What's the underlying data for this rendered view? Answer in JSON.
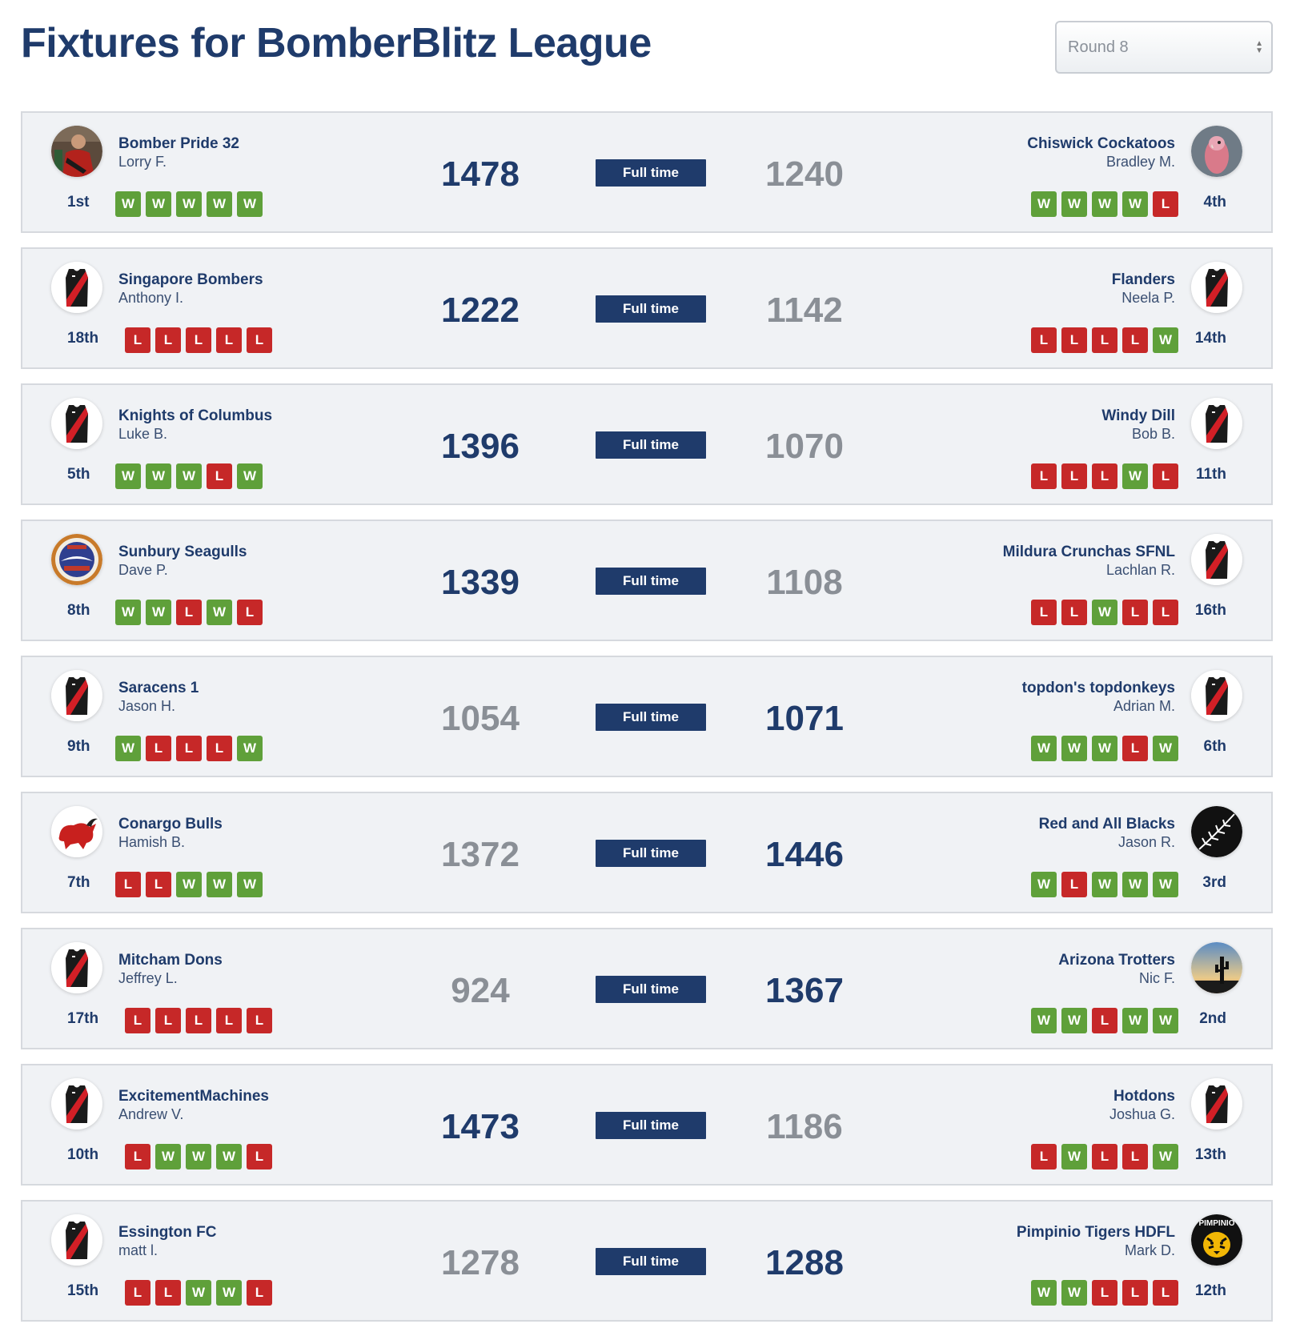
{
  "page": {
    "title": "Fixtures for BomberBlitz League"
  },
  "round_select": {
    "value": "Round 8"
  },
  "colors": {
    "primary": "#1f3b6b",
    "win": "#5fa03a",
    "loss": "#c62828",
    "card_bg": "#f0f2f5"
  },
  "fixtures": [
    {
      "status": "Full time",
      "home": {
        "team": "Bomber Pride 32",
        "coach": "Lorry F.",
        "rank": "1st",
        "form": [
          "W",
          "W",
          "W",
          "W",
          "W"
        ],
        "score": "1478",
        "avatar": "photo-avatar-icon"
      },
      "away": {
        "team": "Chiswick Cockatoos",
        "coach": "Bradley M.",
        "rank": "4th",
        "form": [
          "W",
          "W",
          "W",
          "W",
          "L"
        ],
        "score": "1240",
        "avatar": "cockatoo-avatar-icon"
      },
      "winner": "home"
    },
    {
      "status": "Full time",
      "home": {
        "team": "Singapore Bombers",
        "coach": "Anthony I.",
        "rank": "18th",
        "form": [
          "L",
          "L",
          "L",
          "L",
          "L"
        ],
        "score": "1222",
        "avatar": "guernsey-icon"
      },
      "away": {
        "team": "Flanders",
        "coach": "Neela P.",
        "rank": "14th",
        "form": [
          "L",
          "L",
          "L",
          "L",
          "W"
        ],
        "score": "1142",
        "avatar": "guernsey-icon"
      },
      "winner": "home"
    },
    {
      "status": "Full time",
      "home": {
        "team": "Knights of Columbus",
        "coach": "Luke B.",
        "rank": "5th",
        "form": [
          "W",
          "W",
          "W",
          "L",
          "W"
        ],
        "score": "1396",
        "avatar": "guernsey-icon"
      },
      "away": {
        "team": "Windy Dill",
        "coach": "Bob B.",
        "rank": "11th",
        "form": [
          "L",
          "L",
          "L",
          "W",
          "L"
        ],
        "score": "1070",
        "avatar": "guernsey-icon"
      },
      "winner": "home"
    },
    {
      "status": "Full time",
      "home": {
        "team": "Sunbury Seagulls",
        "coach": "Dave P.",
        "rank": "8th",
        "form": [
          "W",
          "W",
          "L",
          "W",
          "L"
        ],
        "score": "1339",
        "avatar": "seagulls-logo-icon"
      },
      "away": {
        "team": "Mildura Crunchas SFNL",
        "coach": "Lachlan R.",
        "rank": "16th",
        "form": [
          "L",
          "L",
          "W",
          "L",
          "L"
        ],
        "score": "1108",
        "avatar": "guernsey-icon"
      },
      "winner": "home"
    },
    {
      "status": "Full time",
      "home": {
        "team": "Saracens 1",
        "coach": "Jason H.",
        "rank": "9th",
        "form": [
          "W",
          "L",
          "L",
          "L",
          "W"
        ],
        "score": "1054",
        "avatar": "guernsey-icon"
      },
      "away": {
        "team": "topdon's topdonkeys",
        "coach": "Adrian M.",
        "rank": "6th",
        "form": [
          "W",
          "W",
          "W",
          "L",
          "W"
        ],
        "score": "1071",
        "avatar": "guernsey-icon"
      },
      "winner": "away"
    },
    {
      "status": "Full time",
      "home": {
        "team": "Conargo Bulls",
        "coach": "Hamish B.",
        "rank": "7th",
        "form": [
          "L",
          "L",
          "W",
          "W",
          "W"
        ],
        "score": "1372",
        "avatar": "bull-logo-icon"
      },
      "away": {
        "team": "Red and All Blacks",
        "coach": "Jason R.",
        "rank": "3rd",
        "form": [
          "W",
          "L",
          "W",
          "W",
          "W"
        ],
        "score": "1446",
        "avatar": "silver-fern-icon"
      },
      "winner": "away"
    },
    {
      "status": "Full time",
      "home": {
        "team": "Mitcham Dons",
        "coach": "Jeffrey L.",
        "rank": "17th",
        "form": [
          "L",
          "L",
          "L",
          "L",
          "L"
        ],
        "score": "924",
        "avatar": "guernsey-icon"
      },
      "away": {
        "team": "Arizona Trotters",
        "coach": "Nic F.",
        "rank": "2nd",
        "form": [
          "W",
          "W",
          "L",
          "W",
          "W"
        ],
        "score": "1367",
        "avatar": "cactus-photo-icon"
      },
      "winner": "away"
    },
    {
      "status": "Full time",
      "home": {
        "team": "ExcitementMachines",
        "coach": "Andrew V.",
        "rank": "10th",
        "form": [
          "L",
          "W",
          "W",
          "W",
          "L"
        ],
        "score": "1473",
        "avatar": "guernsey-icon"
      },
      "away": {
        "team": "Hotdons",
        "coach": "Joshua G.",
        "rank": "13th",
        "form": [
          "L",
          "W",
          "L",
          "L",
          "W"
        ],
        "score": "1186",
        "avatar": "guernsey-icon"
      },
      "winner": "home"
    },
    {
      "status": "Full time",
      "home": {
        "team": "Essington FC",
        "coach": "matt l.",
        "rank": "15th",
        "form": [
          "L",
          "L",
          "W",
          "W",
          "L"
        ],
        "score": "1278",
        "avatar": "guernsey-icon"
      },
      "away": {
        "team": "Pimpinio Tigers HDFL",
        "coach": "Mark D.",
        "rank": "12th",
        "form": [
          "W",
          "W",
          "L",
          "L",
          "L"
        ],
        "score": "1288",
        "avatar": "tiger-logo-icon",
        "avatar_text": "PIMPINIO"
      },
      "winner": "away"
    }
  ]
}
